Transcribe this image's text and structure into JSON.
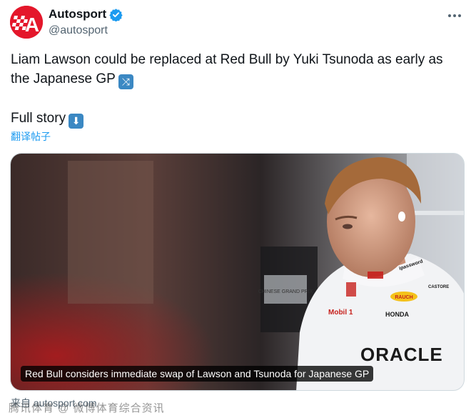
{
  "author": {
    "display_name": "Autosport",
    "handle": "@autosport",
    "avatar_icon": "autosport-logo-icon",
    "verified_icon": "verified-badge-icon",
    "brand_color": "#e4172b"
  },
  "menu": {
    "icon": "more-options-icon"
  },
  "tweet": {
    "line1": "Liam Lawson could be replaced at Red Bull by Yuki Tsunoda as early as the Japanese GP",
    "line1_emoji_icon": "shuffle-emoji-icon",
    "line2": "Full story",
    "line2_emoji_icon": "down-arrow-emoji-icon",
    "translate_label": "翻译帖子"
  },
  "card": {
    "headline": "Red Bull considers immediate swap of Lawson and Tsunoda for Japanese GP",
    "source": "来自 autosport.com",
    "photo_sponsor_text": [
      "ORACLE",
      "HONDA",
      "Mobil 1",
      "CASTORE",
      "RAUCH",
      "ipassword"
    ],
    "photo_screen_text": "CHINESE GRAND PRIX"
  },
  "watermark": "腾讯体育 @ 微博体育综合资讯"
}
